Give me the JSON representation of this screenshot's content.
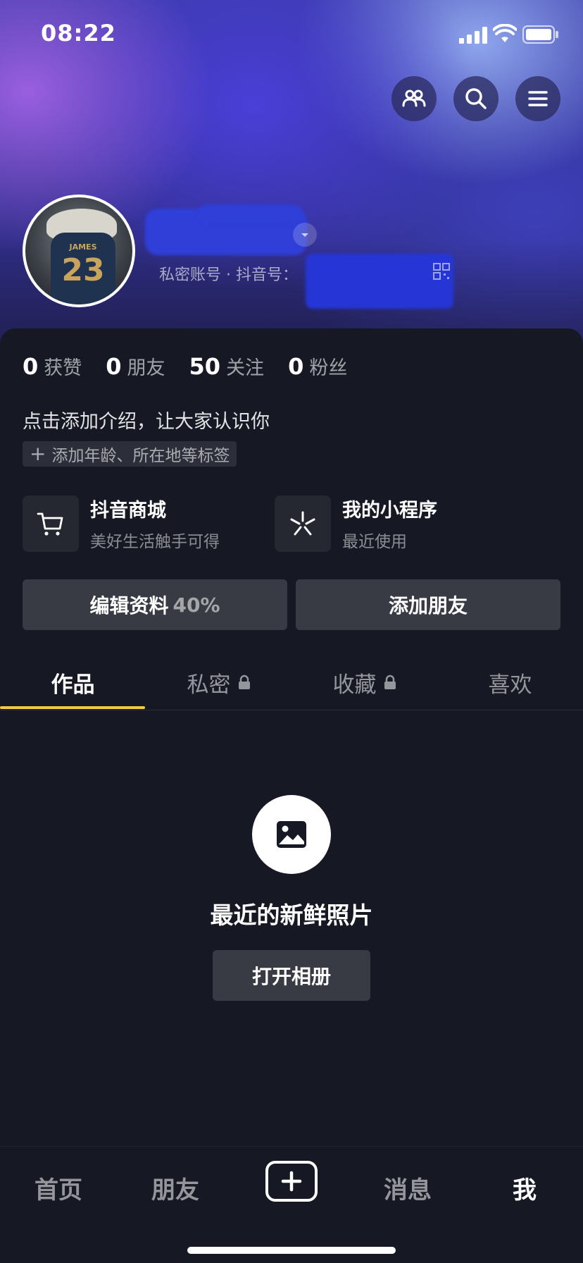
{
  "status_bar": {
    "time": "08:22"
  },
  "profile": {
    "account_line": "私密账号 · 抖音号：",
    "avatar": {
      "jersey_name": "JAMES",
      "jersey_number": "23"
    }
  },
  "stats": [
    {
      "num": "0",
      "label": "获赞"
    },
    {
      "num": "0",
      "label": "朋友"
    },
    {
      "num": "50",
      "label": "关注"
    },
    {
      "num": "0",
      "label": "粉丝"
    }
  ],
  "bio": "点击添加介绍，让大家认识你",
  "tag_chip": {
    "plus": "+",
    "label": "添加年龄、所在地等标签"
  },
  "features": [
    {
      "title": "抖音商城",
      "subtitle": "美好生活触手可得",
      "icon": "cart-icon"
    },
    {
      "title": "我的小程序",
      "subtitle": "最近使用",
      "icon": "mini-program-icon"
    }
  ],
  "actions": {
    "edit_profile": "编辑资料",
    "edit_percent": "40%",
    "add_friends": "添加朋友"
  },
  "tabs": [
    {
      "label": "作品",
      "active": true,
      "locked": false
    },
    {
      "label": "私密",
      "active": false,
      "locked": true
    },
    {
      "label": "收藏",
      "active": false,
      "locked": true
    },
    {
      "label": "喜欢",
      "active": false,
      "locked": false
    }
  ],
  "empty_state": {
    "title": "最近的新鲜照片",
    "button": "打开相册",
    "icon": "image-icon"
  },
  "bottom_nav": [
    {
      "label": "首页",
      "active": false
    },
    {
      "label": "朋友",
      "active": false
    },
    {
      "label": "消息",
      "active": false
    },
    {
      "label": "我",
      "active": true
    }
  ],
  "colors": {
    "background": "#161823",
    "tab_indicator": "#f3ca44",
    "button_bg": "#393b44"
  }
}
